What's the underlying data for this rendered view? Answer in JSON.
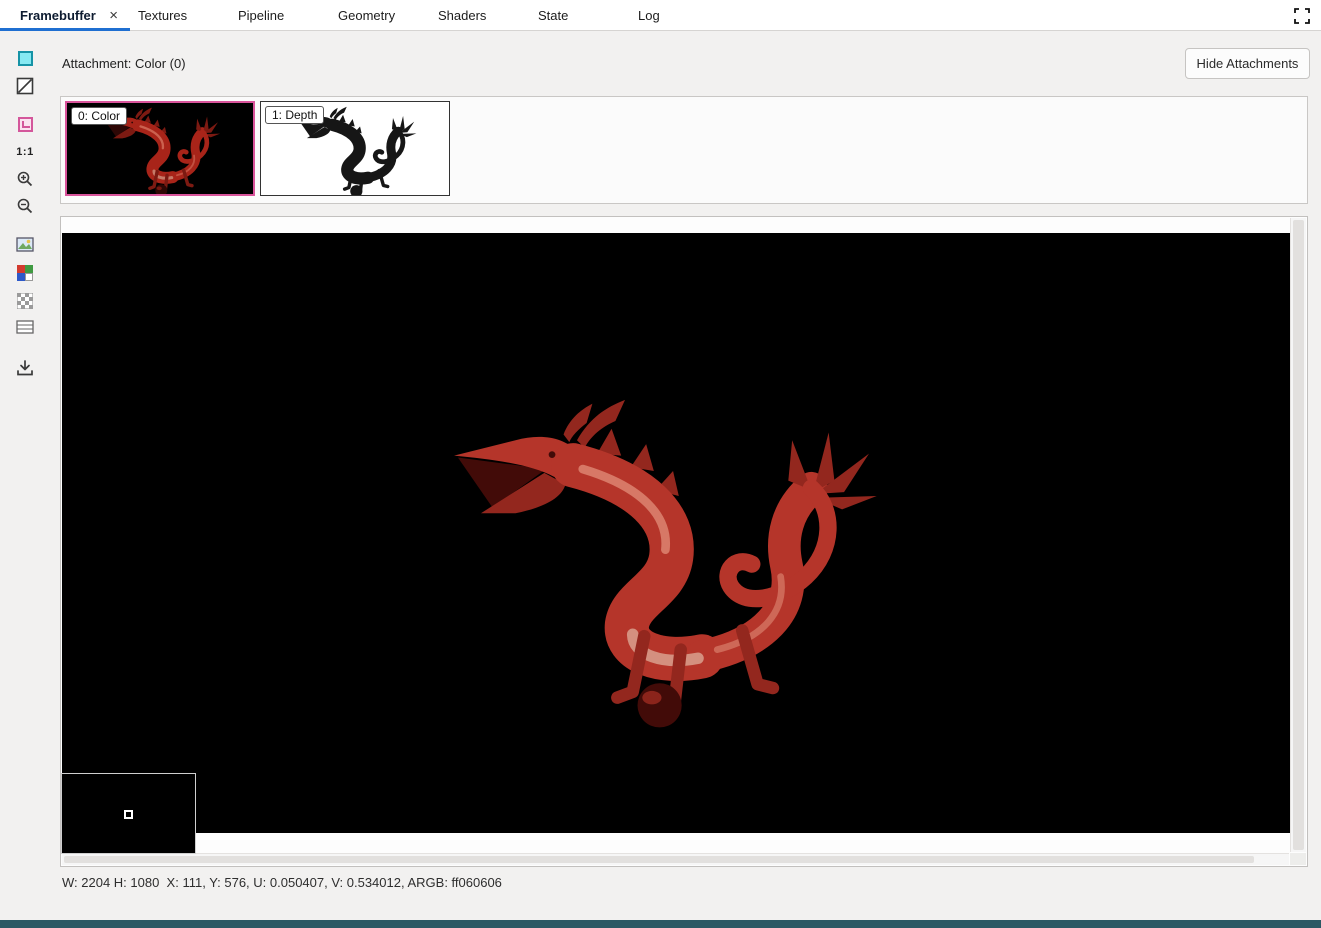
{
  "window": {
    "tabs": [
      {
        "label": "Framebuffer",
        "active": true,
        "closable": true
      },
      {
        "label": "Textures"
      },
      {
        "label": "Pipeline"
      },
      {
        "label": "Geometry"
      },
      {
        "label": "Shaders"
      },
      {
        "label": "State"
      },
      {
        "label": "Log"
      }
    ],
    "close_glyph": "×"
  },
  "header": {
    "attachment_label": "Attachment: Color (0)",
    "hide_attachments_button": "Hide Attachments"
  },
  "attachments": {
    "items": [
      {
        "label": "0: Color",
        "type": "color",
        "selected": true
      },
      {
        "label": "1: Depth",
        "type": "depth",
        "selected": false
      }
    ]
  },
  "toolbar": {
    "zoom_reset_label": "1:1",
    "icons": [
      "color-channel-icon",
      "alpha-channel-icon",
      "pick-region-icon",
      "zoom-1to1-icon",
      "zoom-in-icon",
      "zoom-out-icon",
      "image-icon",
      "color-palette-icon",
      "checkerboard-icon",
      "background-icon",
      "save-icon"
    ]
  },
  "status": {
    "text": "W: 2204 H: 1080  X: 111, Y: 576, U: 0.050407, V: 0.534012, ARGB: ff060606"
  },
  "colors": {
    "selected_attachment_border": "#d9549b",
    "active_tab_underline": "#1f6fd1",
    "canvas_background": "#000000",
    "pixel_argb": "ff060606"
  }
}
